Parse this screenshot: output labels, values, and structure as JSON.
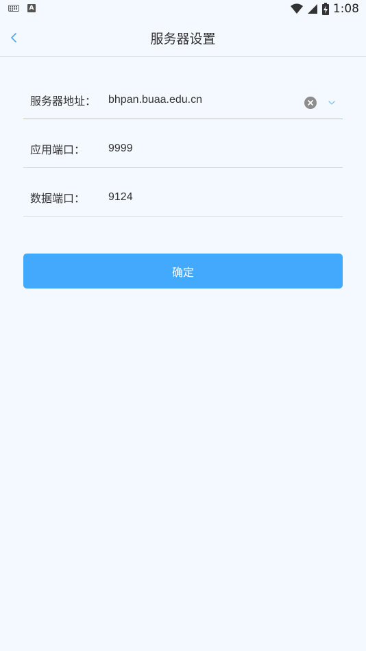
{
  "status_bar": {
    "time": "1:08",
    "icons": [
      "keyboard-icon",
      "a-notification-icon",
      "wifi-icon",
      "signal-icon",
      "battery-charging-icon"
    ]
  },
  "header": {
    "title": "服务器设置",
    "back_icon": "chevron-left-icon"
  },
  "form": {
    "server_address": {
      "label": "服务器地址：",
      "value": "bhpan.buaa.edu.cn"
    },
    "app_port": {
      "label": "应用端口：",
      "value": "9999"
    },
    "data_port": {
      "label": "数据端口：",
      "value": "9124"
    }
  },
  "confirm_button": {
    "label": "确定"
  },
  "colors": {
    "background": "#f4f8ff",
    "accent": "#43a9fc",
    "active_underline": "#9ccbe8"
  }
}
